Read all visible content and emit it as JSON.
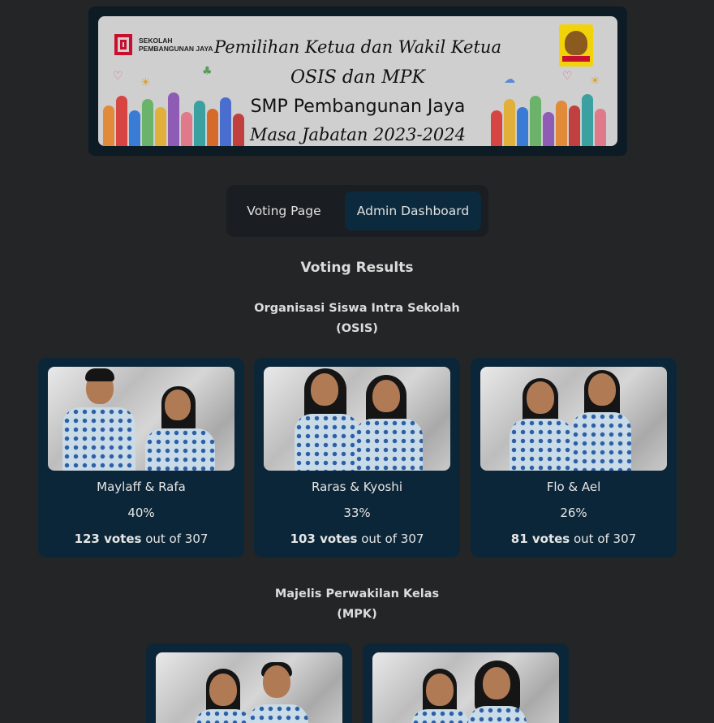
{
  "banner": {
    "school_name_line1": "SEKOLAH",
    "school_name_line2": "PEMBANGUNAN JAYA",
    "line1": "Pemilihan Ketua dan Wakil Ketua",
    "line2": "OSIS dan MPK",
    "line3": "SMP Pembangunan Jaya",
    "line4": "Masa Jabatan 2023-2024",
    "badge_icon": "osis-emblem-icon",
    "logo_icon": "school-logo-icon"
  },
  "tabs": {
    "voting": "Voting Page",
    "admin": "Admin Dashboard",
    "active": "admin"
  },
  "results": {
    "title": "Voting Results",
    "osis": {
      "title_line1": "Organisasi Siswa Intra Sekolah",
      "title_line2": "(OSIS)",
      "candidates": [
        {
          "name": "Maylaff & Rafa",
          "percent": "40%",
          "votes": "123 votes",
          "out_of": " out of 307"
        },
        {
          "name": "Raras & Kyoshi",
          "percent": "33%",
          "votes": "103 votes",
          "out_of": " out of 307"
        },
        {
          "name": "Flo & Ael",
          "percent": "26%",
          "votes": "81 votes",
          "out_of": " out of 307"
        }
      ]
    },
    "mpk": {
      "title_line1": "Majelis Perwakilan Kelas",
      "title_line2": "(MPK)"
    }
  },
  "colors": {
    "page_bg": "#242526",
    "card_bg": "#0b2638",
    "active_tab_bg": "#0c2a3d",
    "tabs_bg": "#1a1e22"
  }
}
